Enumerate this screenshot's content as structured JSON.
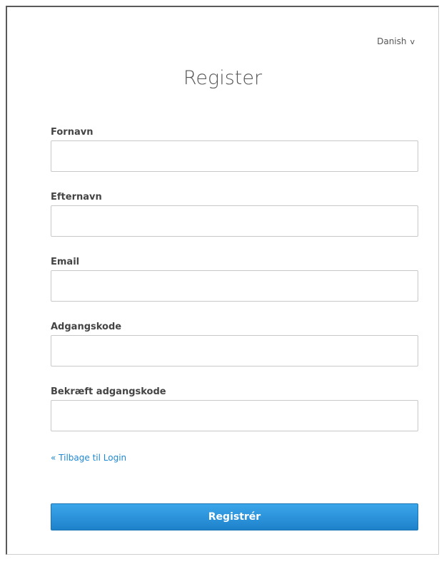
{
  "header": {
    "language": "Danish",
    "language_chevron": "v",
    "title": "Register"
  },
  "form": {
    "fields": [
      {
        "label": "Fornavn",
        "value": "",
        "placeholder": ""
      },
      {
        "label": "Efternavn",
        "value": "",
        "placeholder": ""
      },
      {
        "label": "Email",
        "value": "",
        "placeholder": ""
      },
      {
        "label": "Adgangskode",
        "value": "",
        "placeholder": ""
      },
      {
        "label": "Bekræft adgangskode",
        "value": "",
        "placeholder": ""
      }
    ],
    "back_link": "« Tilbage til Login",
    "submit_label": "Registrér"
  },
  "colors": {
    "accent": "#2a93dc",
    "link": "#1e88d0"
  }
}
